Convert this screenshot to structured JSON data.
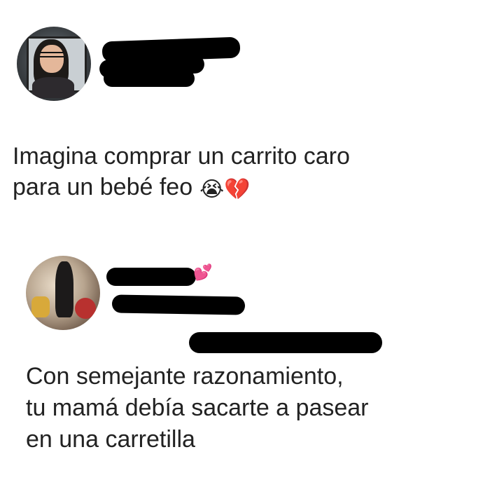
{
  "posts": [
    {
      "text_line1": "Imagina comprar un carrito caro",
      "text_line2": "para un bebé feo",
      "emojis": [
        "😭",
        "💔"
      ]
    },
    {
      "text_line1": "Con semejante razonamiento,",
      "text_line2": "tu mamá debía sacarte a pasear",
      "text_line3": "en una carretilla",
      "decoration_emoji": "💕"
    }
  ]
}
